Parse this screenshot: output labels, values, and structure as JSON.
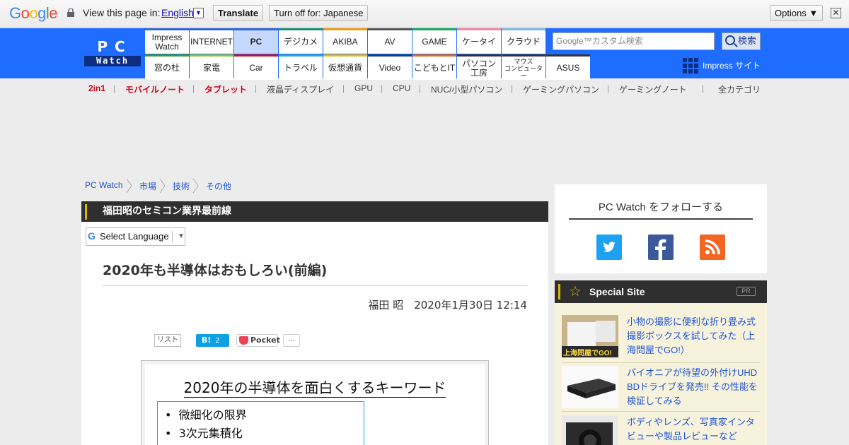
{
  "translate_bar": {
    "logo": "Google",
    "view_text": "View this page in:",
    "language": "English",
    "lang_arrow": "▼",
    "translate_label": "Translate",
    "turn_off_label": "Turn off for: Japanese",
    "options_label": "Options ▼",
    "close_label": "✕"
  },
  "header": {
    "logo_top": "PC",
    "logo_bottom": "Watch",
    "nav_row1": [
      {
        "label": "Impress\nWatch",
        "color": "#2d63d8"
      },
      {
        "label": "INTERNET",
        "color": "#2d63d8"
      },
      {
        "label": "PC",
        "color": "#2d63d8",
        "active": true
      },
      {
        "label": "デジカメ",
        "color": "#1b8c6e"
      },
      {
        "label": "AKIBA",
        "color": "#e69a1a"
      },
      {
        "label": "AV",
        "color": "#555555"
      },
      {
        "label": "GAME",
        "color": "#19a55a"
      },
      {
        "label": "ケータイ",
        "color": "#e68aa8"
      },
      {
        "label": "クラウド",
        "color": "#7fb5e8"
      }
    ],
    "nav_row2": [
      {
        "label": "窓の杜",
        "color": "#3a9a3a"
      },
      {
        "label": "家電",
        "color": "#8cc43e"
      },
      {
        "label": "Car",
        "color": "#c8102e"
      },
      {
        "label": "トラベル",
        "color": "#2aa6d6"
      },
      {
        "label": "仮想通貨",
        "color": "#e6b81a"
      },
      {
        "label": "Video",
        "color": "#123f8c"
      },
      {
        "label": "こどもとIT",
        "color": "#e26a1c"
      },
      {
        "label": "パソコン\n工房",
        "color": "#333333"
      },
      {
        "label": "マウス\nコンピューター",
        "color": "#333333",
        "small": true
      },
      {
        "label": "ASUS",
        "color": "#333333"
      }
    ],
    "search_placeholder": "Google™カスタム検索",
    "search_button": "検索",
    "impress_site": "Impress サイト"
  },
  "categories": [
    {
      "label": "2in1",
      "red": true
    },
    {
      "label": "モバイルノート",
      "red": true
    },
    {
      "label": "タブレット",
      "red": true
    },
    {
      "label": "液晶ディスプレイ"
    },
    {
      "label": "GPU"
    },
    {
      "label": "CPU"
    },
    {
      "label": "NUC/小型パソコン"
    },
    {
      "label": "ゲーミングパソコン"
    },
    {
      "label": "ゲーミングノート"
    }
  ],
  "all_categories": "全カテゴリ",
  "breadcrumb": [
    "PC Watch",
    "市場",
    "技術",
    "その他"
  ],
  "article": {
    "series": "福田昭のセミコン業界最前線",
    "select_language": "Select Language",
    "title": "2020年も半導体はおもしろい(前編)",
    "byline": "福田 昭　2020年1月30日 12:14",
    "share_list": "リスト",
    "share_hatena": "B!",
    "share_hatena_count": "2",
    "share_pocket": "Pocket",
    "share_more": "…",
    "slide_title": "2020年の半導体を面白くするキーワード",
    "slide_items": [
      "微細化の限界",
      "3次元集積化"
    ]
  },
  "sidebar": {
    "follow_title": "PC Watch をフォローする",
    "special_title": "Special Site",
    "pr_label": "PR",
    "special_items": [
      "小物の撮影に便利な折り畳み式撮影ボックスを試してみた（上海問屋でGO!）",
      "パイオニアが待望の外付けUHD BDドライブを発売!! その性能を検証してみる",
      "ボディやレンズ、写真家インタビューや製品レビューなど"
    ],
    "thumb_label": "上海問屋でGO!"
  }
}
